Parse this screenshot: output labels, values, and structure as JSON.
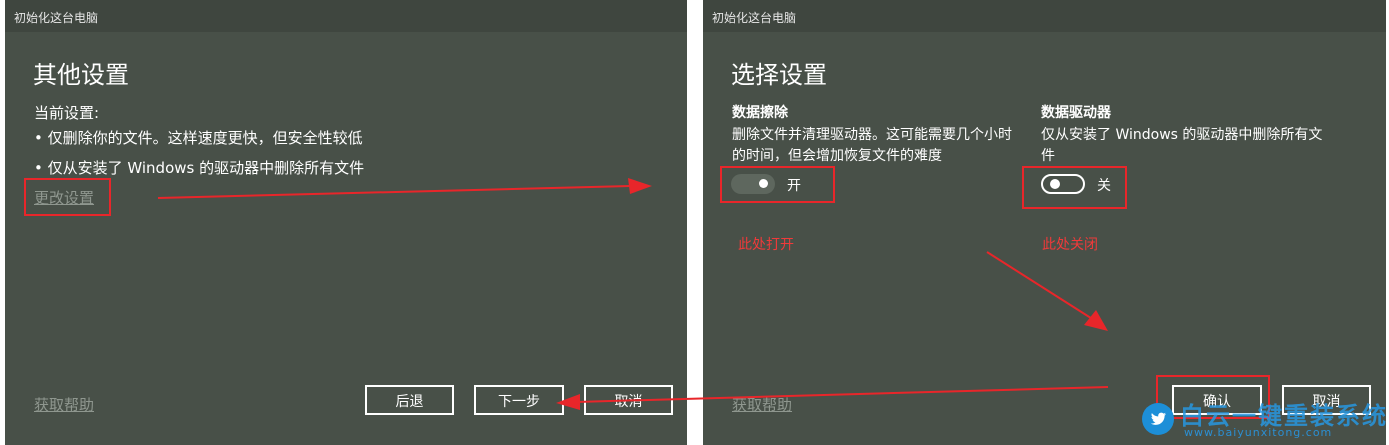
{
  "left_dialog": {
    "window_title": "初始化这台电脑",
    "heading": "其他设置",
    "current_label": "当前设置:",
    "bullets": [
      "• 仅删除你的文件。这样速度更快，但安全性较低",
      "• 仅从安装了 Windows 的驱动器中删除所有文件"
    ],
    "change_settings_link": "更改设置",
    "help_link": "获取帮助",
    "back_button": "后退",
    "next_button": "下一步",
    "cancel_button": "取消"
  },
  "right_dialog": {
    "window_title": "初始化这台电脑",
    "heading": "选择设置",
    "data_erase": {
      "title": "数据擦除",
      "desc_line1": "删除文件并清理驱动器。这可能需要几个小时",
      "desc_line2": "的时间，但会增加恢复文件的难度",
      "state": "开"
    },
    "data_drives": {
      "title": "数据驱动器",
      "desc_line1": "仅从安装了 Windows 的驱动器中删除所有文",
      "desc_line2": "件",
      "state": "关"
    },
    "help_link": "获取帮助",
    "confirm_button": "确认",
    "cancel_button": "取消"
  },
  "annotations": {
    "turn_on_note": "此处打开",
    "turn_off_note": "此处关闭",
    "color": "#e8262a"
  },
  "watermark": {
    "brand": "白云一键重装系统",
    "url": "www.baiyunxitong.com",
    "icon": "twitter-bird-icon"
  }
}
